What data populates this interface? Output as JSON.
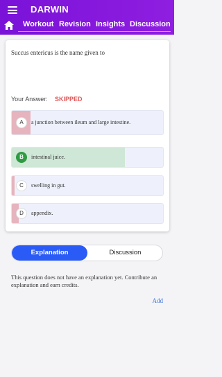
{
  "appbar": {
    "title": "DARWIN",
    "tabs": [
      "Workout",
      "Revision",
      "Insights",
      "Discussion"
    ]
  },
  "question": {
    "text": "Succus entericus is the name given to",
    "your_answer_label": "Your Answer:",
    "your_answer_value": "SKIPPED"
  },
  "options": [
    {
      "letter": "A",
      "text": "a junction between ileum and large intestine."
    },
    {
      "letter": "B",
      "text": "intestinal juice."
    },
    {
      "letter": "C",
      "text": "swelling in gut."
    },
    {
      "letter": "D",
      "text": "appendix."
    }
  ],
  "segmented": {
    "active": "Explanation",
    "inactive": "Discussion"
  },
  "explanation": {
    "text": "This question does not have an explanation yet. Contribute an explanation and earn credits.",
    "add_label": "Add"
  },
  "colors": {
    "appbar": "#8312dc",
    "accent": "#2a5bf7",
    "correct": "#2e9b43",
    "skipped": "#e0595a"
  }
}
